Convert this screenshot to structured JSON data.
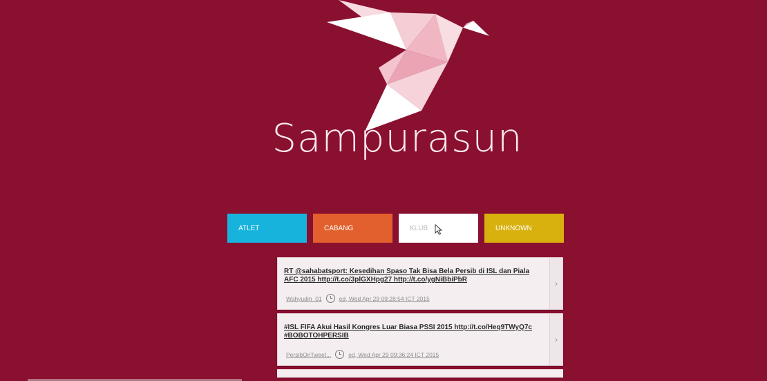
{
  "brand": {
    "name": "Sampurasun"
  },
  "tabs": [
    {
      "label": "ATLET"
    },
    {
      "label": "CABANG"
    },
    {
      "label": "KLUB"
    },
    {
      "label": "UNKNOWN"
    }
  ],
  "feed": [
    {
      "text": "RT @sahabatsport: Kesedihan Spaso Tak Bisa Bela Persib di ISL dan Piala AFC 2015 http://t.co/3plGXHpg27 http://t.co/ygNiBbiPbR",
      "user": "Wahyudin_01",
      "time": "ed, Wed Apr 29 09:28:54 ICT 2015"
    },
    {
      "text": "#ISL FIFA Akui Hasil Kongres Luar Biasa PSSI 2015 http://t.co/Heq9TWyQ7c #BOBOTOHPERSIB",
      "user": "PersibOnTweet...",
      "time": "ed, Wed Apr 29 09:36:24 ICT 2015"
    }
  ],
  "colors": {
    "background": "#8a1030",
    "atlet": "#17b3dd",
    "cabang": "#e2602d",
    "klub": "#ffffff",
    "unknown": "#d9b10e"
  },
  "icons": [
    "origami-bird-logo",
    "clock-icon",
    "chevron-right-icon",
    "mouse-cursor-icon"
  ]
}
